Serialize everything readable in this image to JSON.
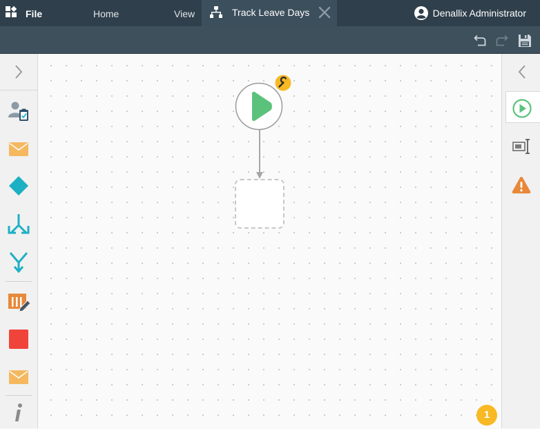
{
  "titlebar": {
    "app_icon": "app-grid-icon",
    "document_tab": {
      "title": "Track Leave Days",
      "icon": "workflow-icon",
      "close_icon": "close-icon"
    },
    "user": {
      "name": "Denallix Administrator",
      "icon": "user-avatar-icon"
    }
  },
  "menu": {
    "items": [
      {
        "label": "File",
        "active": true
      },
      {
        "label": "Home",
        "active": false
      },
      {
        "label": "View",
        "active": false
      }
    ],
    "tools": [
      "undo-icon",
      "redo-icon",
      "save-icon"
    ]
  },
  "left_toolbox": {
    "expand_icon": "chevron-right-icon",
    "items": [
      "user-task-icon",
      "email-icon",
      "decision-icon",
      "split-icon",
      "merge-icon",
      "data-edit-icon",
      "end-icon",
      "email-icon",
      "info-icon"
    ]
  },
  "canvas": {
    "start_node_icon": "play-icon",
    "config_badge_icon": "wrench-icon",
    "notification_count": "1"
  },
  "right_panel": {
    "collapse_icon": "chevron-left-icon",
    "items": [
      "start-properties-icon",
      "form-field-icon",
      "warning-icon"
    ]
  },
  "colors": {
    "titlebar": "#2f3f4b",
    "menubar": "#3e505c",
    "start_green": "#5bc27b",
    "accent_teal": "#1db0c4",
    "badge_yellow": "#f7b924",
    "warning_orange": "#e8883a",
    "end_red": "#f0443a"
  }
}
